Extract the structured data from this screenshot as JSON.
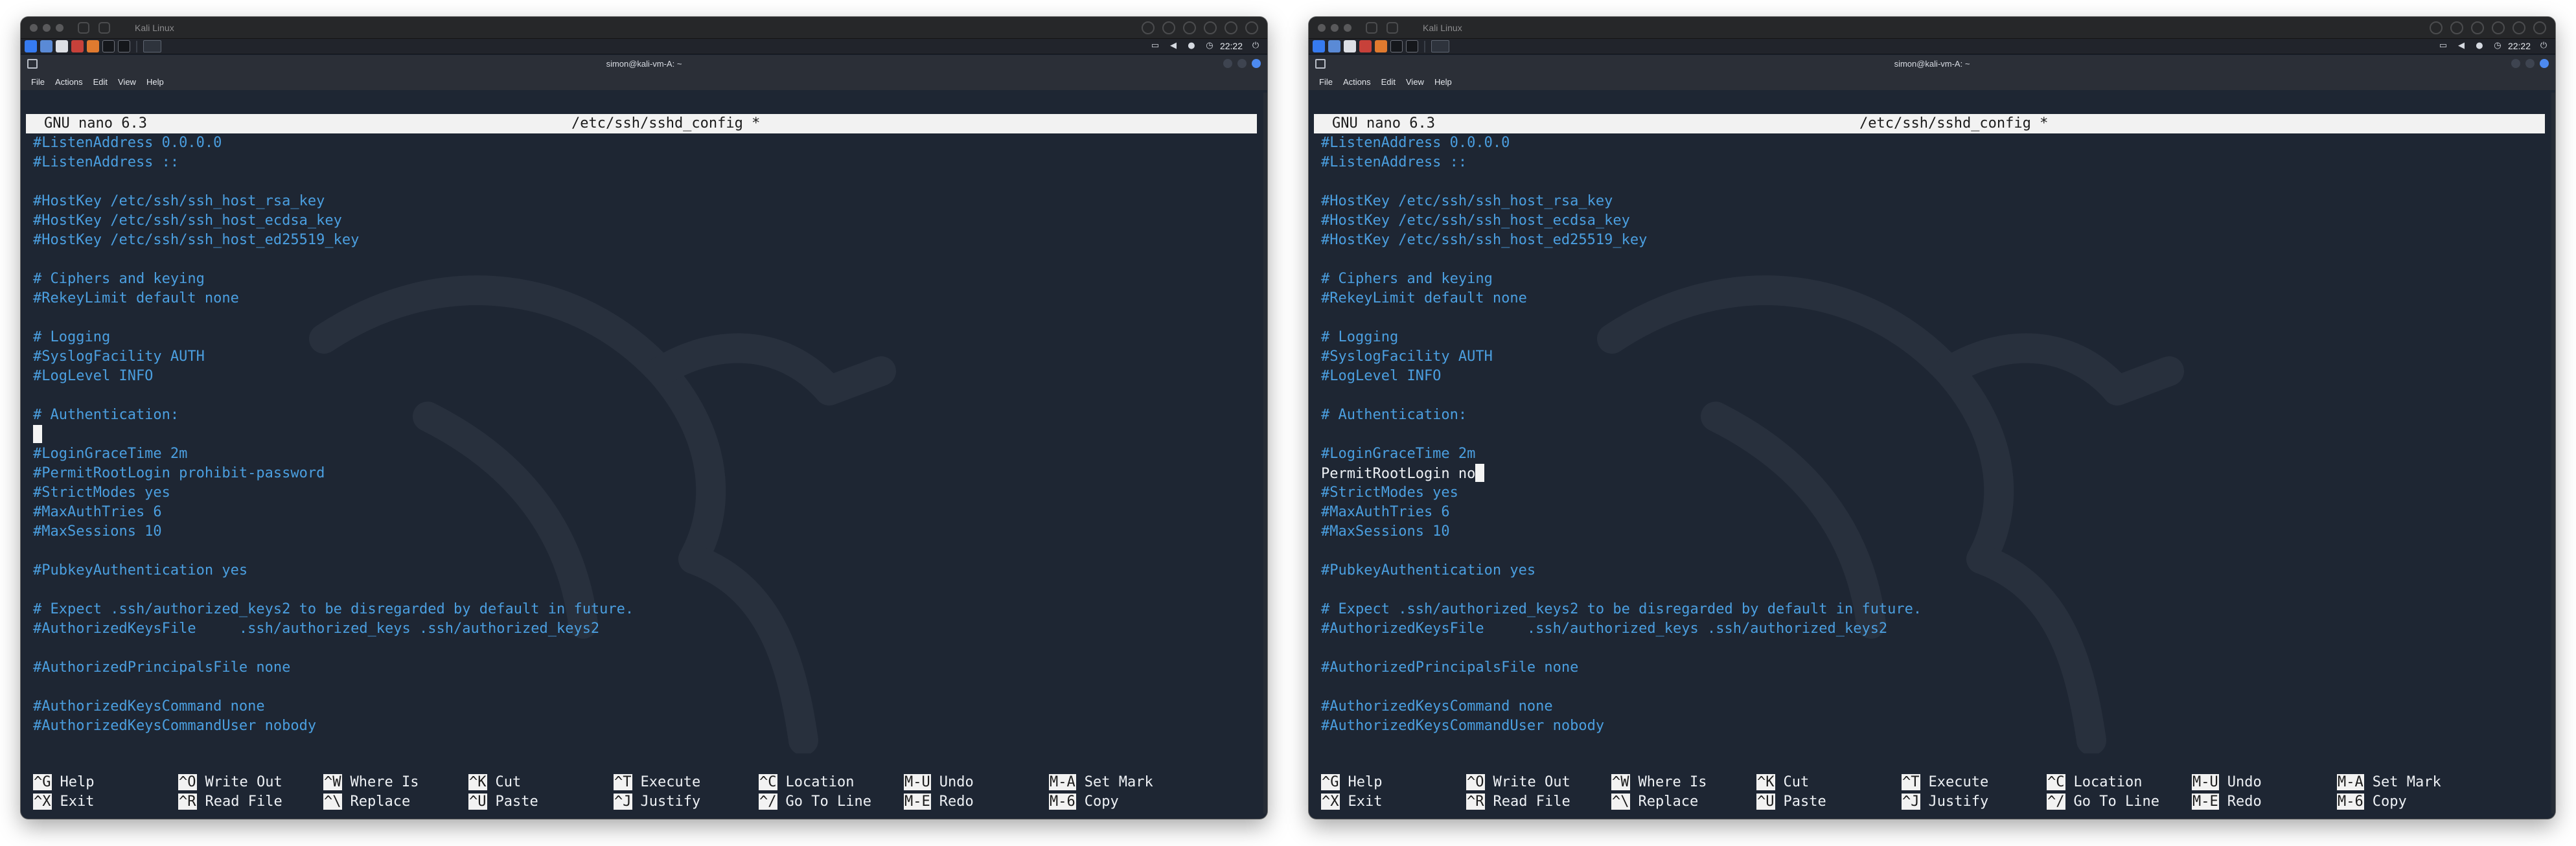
{
  "vm": {
    "host_title": "Kali Linux",
    "clock": "22:22",
    "terminal_title": "simon@kali-vm-A: ~",
    "menu": [
      "File",
      "Actions",
      "Edit",
      "View",
      "Help"
    ]
  },
  "nano": {
    "version": "GNU nano 6.3",
    "filename": "/etc/ssh/sshd_config *"
  },
  "left": {
    "lines": [
      "#ListenAddress 0.0.0.0",
      "#ListenAddress ::",
      "",
      "#HostKey /etc/ssh/ssh_host_rsa_key",
      "#HostKey /etc/ssh/ssh_host_ecdsa_key",
      "#HostKey /etc/ssh/ssh_host_ed25519_key",
      "",
      "# Ciphers and keying",
      "#RekeyLimit default none",
      "",
      "# Logging",
      "#SyslogFacility AUTH",
      "#LogLevel INFO",
      "",
      "# Authentication:",
      "",
      "#LoginGraceTime 2m",
      "#PermitRootLogin prohibit-password",
      "#StrictModes yes",
      "#MaxAuthTries 6",
      "#MaxSessions 10",
      "",
      "#PubkeyAuthentication yes",
      "",
      "# Expect .ssh/authorized_keys2 to be disregarded by default in future.",
      "#AuthorizedKeysFile     .ssh/authorized_keys .ssh/authorized_keys2",
      "",
      "#AuthorizedPrincipalsFile none",
      "",
      "#AuthorizedKeysCommand none",
      "#AuthorizedKeysCommandUser nobody"
    ]
  },
  "right": {
    "lines": [
      "#ListenAddress 0.0.0.0",
      "#ListenAddress ::",
      "",
      "#HostKey /etc/ssh/ssh_host_rsa_key",
      "#HostKey /etc/ssh/ssh_host_ecdsa_key",
      "#HostKey /etc/ssh/ssh_host_ed25519_key",
      "",
      "# Ciphers and keying",
      "#RekeyLimit default none",
      "",
      "# Logging",
      "#SyslogFacility AUTH",
      "#LogLevel INFO",
      "",
      "# Authentication:",
      "",
      "#LoginGraceTime 2m",
      "PermitRootLogin no",
      "#StrictModes yes",
      "#MaxAuthTries 6",
      "#MaxSessions 10",
      "",
      "#PubkeyAuthentication yes",
      "",
      "# Expect .ssh/authorized_keys2 to be disregarded by default in future.",
      "#AuthorizedKeysFile     .ssh/authorized_keys .ssh/authorized_keys2",
      "",
      "#AuthorizedPrincipalsFile none",
      "",
      "#AuthorizedKeysCommand none",
      "#AuthorizedKeysCommandUser nobody"
    ]
  },
  "shortcuts": [
    {
      "key": "^G",
      "label": "Help"
    },
    {
      "key": "^X",
      "label": "Exit"
    },
    {
      "key": "^O",
      "label": "Write Out"
    },
    {
      "key": "^R",
      "label": "Read File"
    },
    {
      "key": "^W",
      "label": "Where Is"
    },
    {
      "key": "^\\",
      "label": "Replace"
    },
    {
      "key": "^K",
      "label": "Cut"
    },
    {
      "key": "^U",
      "label": "Paste"
    },
    {
      "key": "^T",
      "label": "Execute"
    },
    {
      "key": "^J",
      "label": "Justify"
    },
    {
      "key": "^C",
      "label": "Location"
    },
    {
      "key": "^/",
      "label": "Go To Line"
    },
    {
      "key": "M-U",
      "label": "Undo"
    },
    {
      "key": "M-E",
      "label": "Redo"
    },
    {
      "key": "M-A",
      "label": "Set Mark"
    },
    {
      "key": "M-6",
      "label": "Copy"
    }
  ],
  "colors": {
    "comment": "#4b9fe0",
    "plain_text": "#eef1f5",
    "terminal_bg": "#1e2633",
    "header_bg": "#f2f2f2",
    "kali_accent": "#367bf0"
  }
}
